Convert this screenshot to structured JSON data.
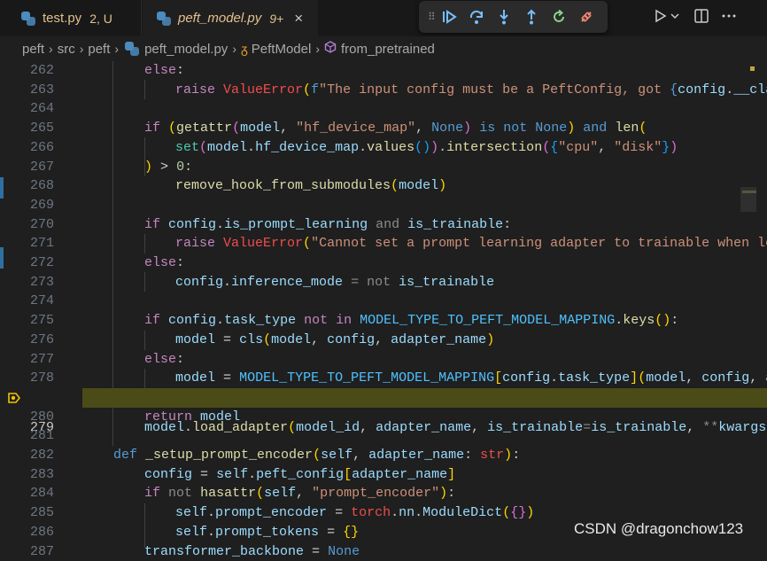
{
  "tabs": [
    {
      "name": "test.py",
      "status": "2, U"
    },
    {
      "name": "peft_model.py",
      "status": "9+",
      "close": "×"
    }
  ],
  "breadcrumb": [
    "peft",
    "src",
    "peft",
    "peft_model.py",
    "PeftModel",
    "from_pretrained"
  ],
  "debug_toolbar": {
    "icons": [
      "grip-icon",
      "continue-icon",
      "step-over-icon",
      "step-into-icon",
      "step-out-icon",
      "restart-icon",
      "disconnect-icon"
    ]
  },
  "right_controls": {
    "icons": [
      "run-icon",
      "chevron-down-icon",
      "split-editor-icon",
      "more-icon"
    ]
  },
  "editor": {
    "line_numbers": [
      "262",
      "263",
      "264",
      "265",
      "266",
      "267",
      "268",
      "269",
      "270",
      "271",
      "272",
      "273",
      "274",
      "275",
      "276",
      "277",
      "278",
      "279",
      "280",
      "281",
      "282",
      "283",
      "284",
      "285",
      "286",
      "287"
    ],
    "current_line": "279"
  },
  "watermark": "CSDN @dragonchow123",
  "colors": {
    "breakpoint": "#f0c000",
    "highlight_line": "#4b4b18"
  }
}
